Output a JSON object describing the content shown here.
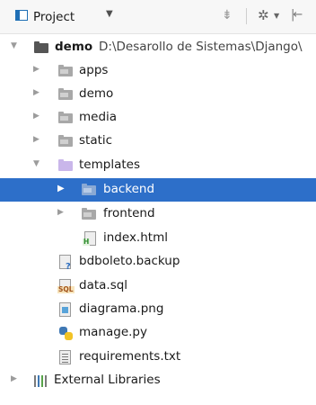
{
  "header": {
    "title": "Project",
    "dropdown_glyph": "▼",
    "collapse_glyph": "⇟",
    "gear_glyph": "✲",
    "gear_dropdown_glyph": "▼",
    "hide_glyph": "|←"
  },
  "tree": {
    "root": {
      "name": "demo",
      "path": "D:\\Desarollo de Sistemas\\Django\\",
      "expanded": true
    },
    "items": [
      {
        "label": "apps",
        "icon": "folder-icon",
        "expanded": false
      },
      {
        "label": "demo",
        "icon": "folder-icon",
        "expanded": false
      },
      {
        "label": "media",
        "icon": "folder-icon",
        "expanded": false
      },
      {
        "label": "static",
        "icon": "folder-icon",
        "expanded": false
      },
      {
        "label": "templates",
        "icon": "templates-folder-icon",
        "expanded": true
      },
      {
        "label": "backend",
        "icon": "folder-icon",
        "expanded": false,
        "selected": true
      },
      {
        "label": "frontend",
        "icon": "folder-icon",
        "expanded": false
      },
      {
        "label": "index.html",
        "icon": "html-file-icon"
      },
      {
        "label": "bdboleto.backup",
        "icon": "unknown-file-icon"
      },
      {
        "label": "data.sql",
        "icon": "sql-file-icon"
      },
      {
        "label": "diagrama.png",
        "icon": "image-file-icon"
      },
      {
        "label": "manage.py",
        "icon": "python-file-icon"
      },
      {
        "label": "requirements.txt",
        "icon": "text-file-icon"
      }
    ],
    "external_libraries": {
      "label": "External Libraries",
      "icon": "library-icon",
      "expanded": false
    }
  },
  "badges": {
    "html": "H",
    "sql": "SQL",
    "unknown": "?"
  },
  "glyphs": {
    "collapsed": "▶",
    "expanded": "▼"
  },
  "colors": {
    "selection": "#2d6fc9",
    "folder": "#a8a8a8",
    "templates_folder": "#c9b6ea"
  }
}
